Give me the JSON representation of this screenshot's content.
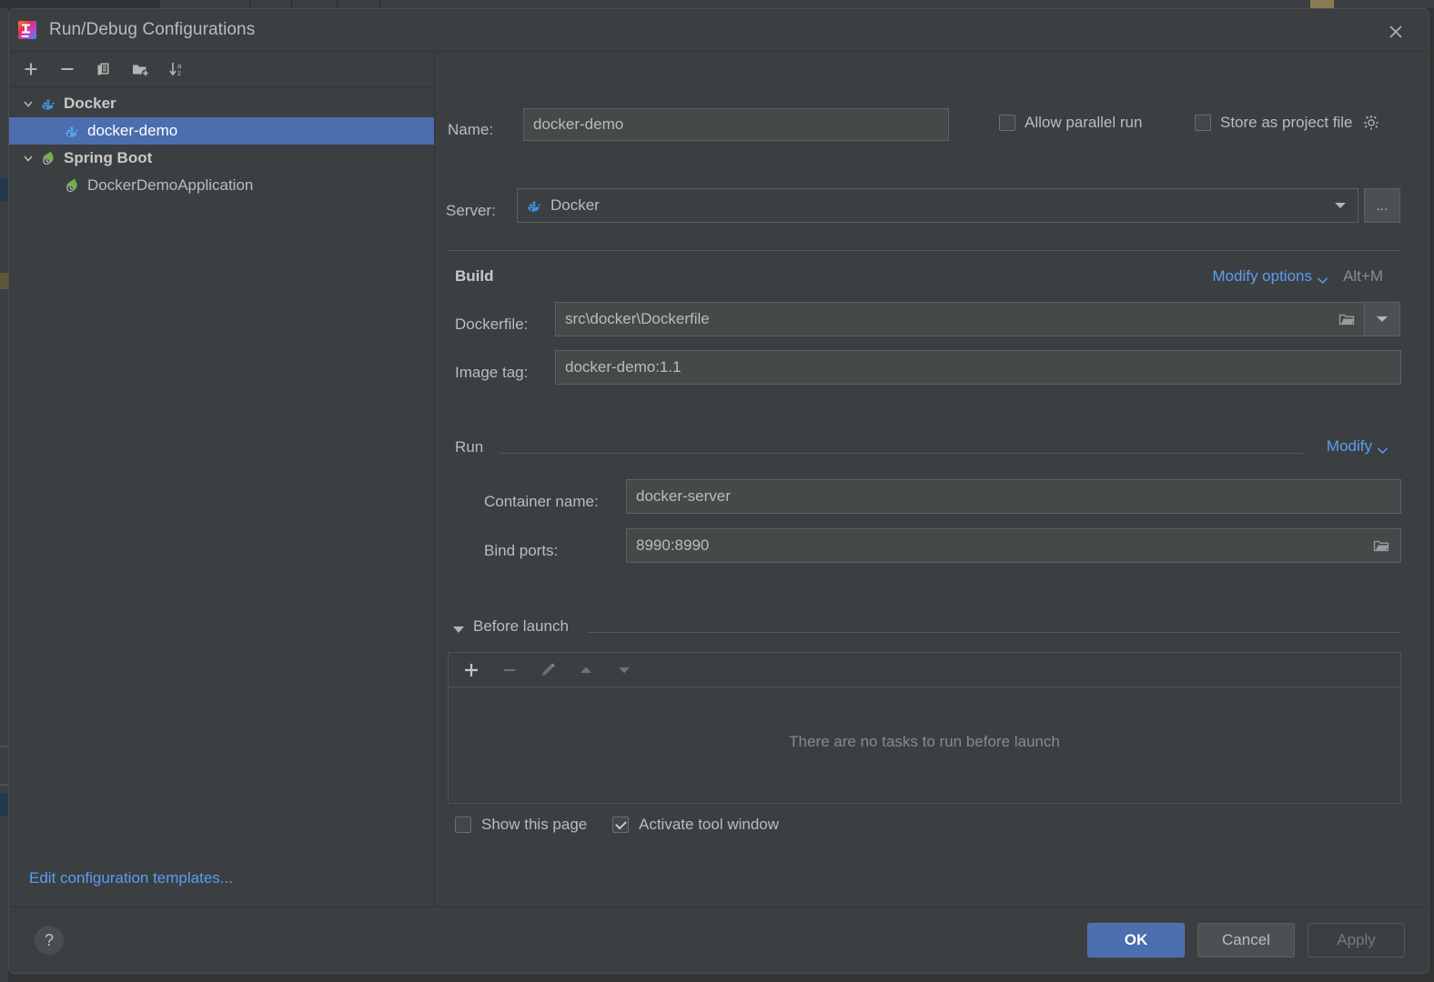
{
  "window": {
    "title": "Run/Debug Configurations",
    "close_icon": "close-icon",
    "app_icon": "intellij-idea-logo"
  },
  "sidebar": {
    "toolbar": [
      {
        "name": "add-configuration-button",
        "icon": "plus-icon",
        "glyph": "+"
      },
      {
        "name": "remove-configuration-button",
        "icon": "minus-icon",
        "glyph": "−"
      },
      {
        "name": "copy-configuration-button",
        "icon": "copy-icon",
        "glyph": "copy"
      },
      {
        "name": "new-folder-button",
        "icon": "folder-add-icon",
        "glyph": "folder-add"
      },
      {
        "name": "sort-configurations-button",
        "icon": "sort-alphabetically-icon",
        "glyph": "sort-az"
      }
    ],
    "tree": [
      {
        "label": "Docker",
        "type": "group",
        "icon": "docker-icon",
        "expanded": true,
        "selected": false
      },
      {
        "label": "docker-demo",
        "type": "child",
        "icon": "docker-icon",
        "expanded": false,
        "selected": true
      },
      {
        "label": "Spring Boot",
        "type": "group",
        "icon": "spring-boot-icon",
        "expanded": true,
        "selected": false
      },
      {
        "label": "DockerDemoApplication",
        "type": "child",
        "icon": "spring-boot-icon",
        "expanded": false,
        "selected": false
      }
    ],
    "edit_templates_link": "Edit configuration templates..."
  },
  "main": {
    "name_label": "Name:",
    "name_value": "docker-demo",
    "allow_parallel_run": {
      "label": "Allow parallel run",
      "checked": false
    },
    "store_as_project_file": {
      "label": "Store as project file",
      "checked": false,
      "gear_icon": "gear-icon"
    },
    "server_label": "Server:",
    "server_value": "Docker",
    "server_icon": "docker-icon",
    "server_browse_label": "...",
    "build": {
      "section_title": "Build",
      "modify_options_link": "Modify options",
      "modify_options_shortcut": "Alt+M",
      "dockerfile_label": "Dockerfile:",
      "dockerfile_value": "src\\docker\\Dockerfile",
      "image_tag_label": "Image tag:",
      "image_tag_value": "docker-demo:1.1"
    },
    "run": {
      "section_title": "Run",
      "modify_link": "Modify",
      "container_name_label": "Container name:",
      "container_name_value": "docker-server",
      "bind_ports_label": "Bind ports:",
      "bind_ports_value": "8990:8990"
    },
    "before_launch": {
      "section_title": "Before launch",
      "toolbar": [
        {
          "name": "add-task-button",
          "icon": "plus-icon",
          "enabled": true
        },
        {
          "name": "remove-task-button",
          "icon": "minus-icon",
          "enabled": false
        },
        {
          "name": "edit-task-button",
          "icon": "pencil-icon",
          "enabled": false
        },
        {
          "name": "move-task-up-button",
          "icon": "arrow-up-icon",
          "enabled": false
        },
        {
          "name": "move-task-down-button",
          "icon": "arrow-down-icon",
          "enabled": false
        }
      ],
      "empty_text": "There are no tasks to run before launch",
      "show_this_page": {
        "label": "Show this page",
        "checked": false
      },
      "activate_tool_window": {
        "label": "Activate tool window",
        "checked": true
      }
    }
  },
  "footer": {
    "help_label": "?",
    "ok_label": "OK",
    "cancel_label": "Cancel",
    "apply_label": "Apply"
  },
  "colors": {
    "dialog_bg": "#3c3f41",
    "field_bg": "#45494a",
    "selection_blue": "#4b6eaf",
    "link_blue": "#589df6",
    "text": "#bbbbbb",
    "muted_text": "#898989",
    "docker_blue": "#3f8fd8",
    "spring_green": "#6db33f"
  }
}
